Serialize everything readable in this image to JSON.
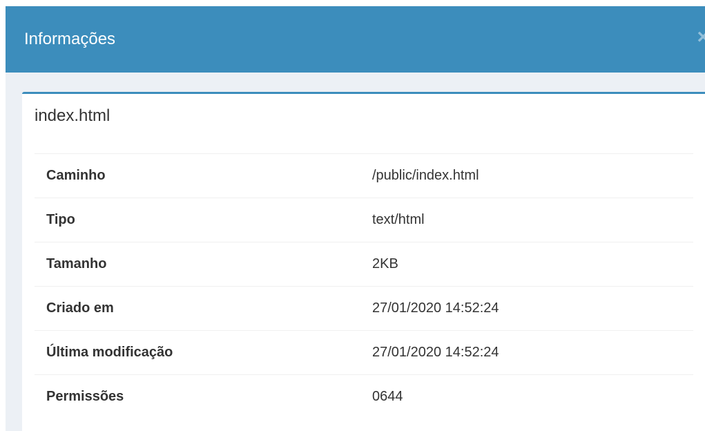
{
  "modal": {
    "title": "Informações",
    "close_label": "×"
  },
  "file": {
    "name": "index.html",
    "rows": [
      {
        "label": "Caminho",
        "value": "/public/index.html"
      },
      {
        "label": "Tipo",
        "value": "text/html"
      },
      {
        "label": "Tamanho",
        "value": "2KB"
      },
      {
        "label": "Criado em",
        "value": "27/01/2020 14:52:24"
      },
      {
        "label": "Última modificação",
        "value": "27/01/2020 14:52:24"
      },
      {
        "label": "Permissões",
        "value": "0644"
      }
    ]
  },
  "colors": {
    "header": "#3c8dbc",
    "body_background": "#ecf0f5",
    "box_accent": "#3c8dbc"
  }
}
